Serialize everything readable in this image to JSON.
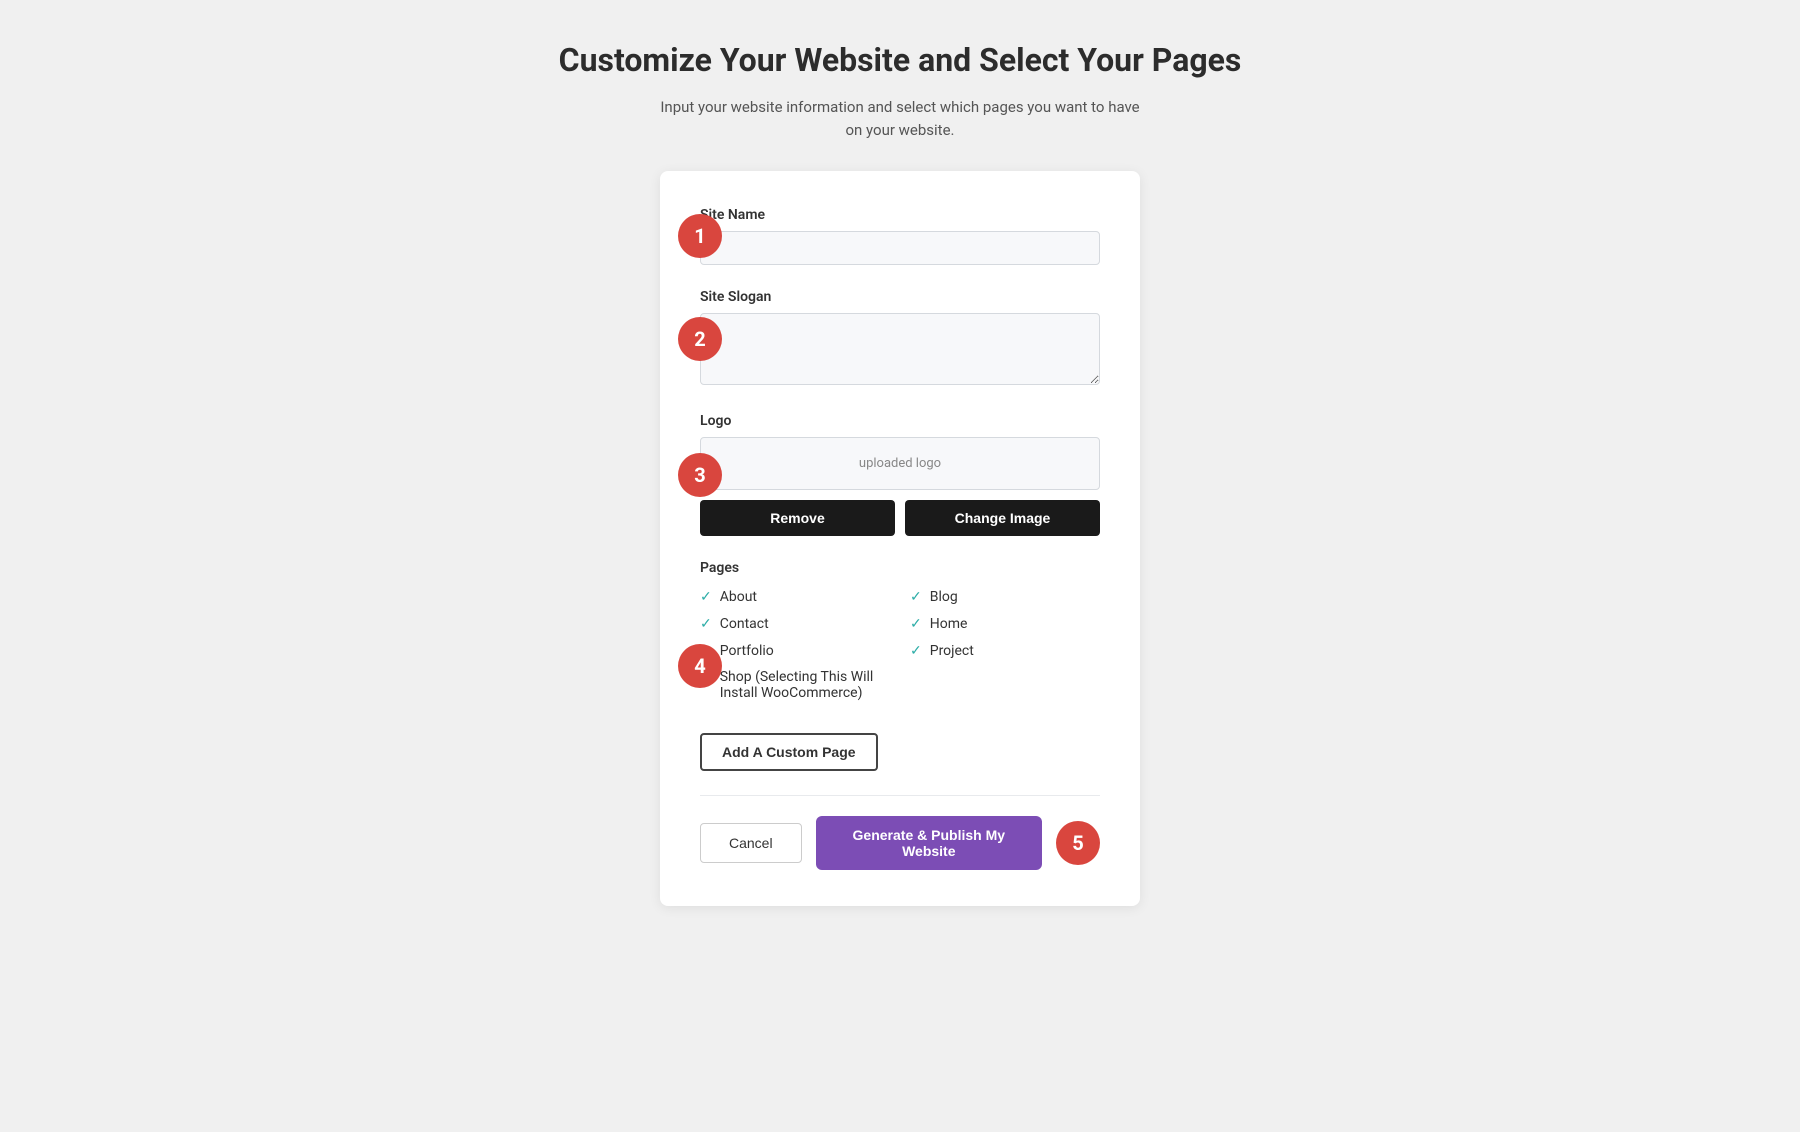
{
  "header": {
    "title": "Customize Your Website and Select Your Pages",
    "subtitle": "Input your website information and select which pages you want to have on your website."
  },
  "steps": {
    "step1": "1",
    "step2": "2",
    "step3": "3",
    "step4": "4",
    "step5": "5"
  },
  "form": {
    "site_name_label": "Site Name",
    "site_name_placeholder": "",
    "site_slogan_label": "Site Slogan",
    "site_slogan_placeholder": "",
    "logo_label": "Logo",
    "logo_preview": "uploaded logo",
    "remove_button": "Remove",
    "change_image_button": "Change Image",
    "pages_label": "Pages",
    "pages": [
      {
        "name": "About",
        "checked": true
      },
      {
        "name": "Blog",
        "checked": true
      },
      {
        "name": "Contact",
        "checked": true
      },
      {
        "name": "Home",
        "checked": true
      },
      {
        "name": "Portfolio",
        "checked": true
      },
      {
        "name": "Project",
        "checked": true
      },
      {
        "name": "Shop (Selecting This Will Install WooCommerce)",
        "checked": true
      }
    ],
    "add_custom_page_button": "Add A Custom Page",
    "cancel_button": "Cancel",
    "publish_button": "Generate & Publish My Website"
  },
  "colors": {
    "badge_red": "#d9463e",
    "teal_check": "#2dada7",
    "publish_purple": "#7c4db5"
  }
}
